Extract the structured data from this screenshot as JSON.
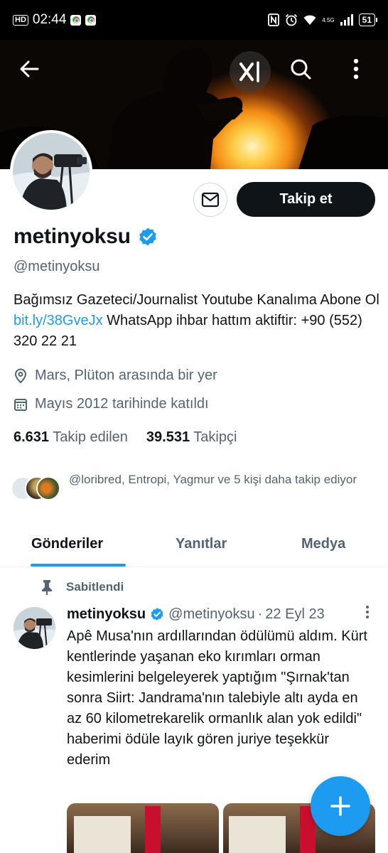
{
  "status_bar": {
    "hd": "HD",
    "time": "02:44",
    "network": "4.5G",
    "battery": "51"
  },
  "header": {
    "icons": [
      "back-arrow-icon",
      "grok-icon",
      "search-icon",
      "more-vertical-icon"
    ]
  },
  "profile": {
    "display_name": "metinyoksu",
    "verified": true,
    "handle": "@metinyoksu",
    "follow_label": "Takip et",
    "bio_part1": "Bağımsız Gazeteci/Journalist  Youtube Kanalıma Abone Ol ",
    "bio_link": "bit.ly/38GveJx",
    "bio_part2": "  WhatsApp ihbar hattım aktiftir:  +90 (552) 320 22 21",
    "location": "Mars, Plüton arasında bir yer",
    "joined": "Mayıs 2012 tarihinde katıldı",
    "following_count": "6.631",
    "following_label": "Takip edilen",
    "followers_count": "39.531",
    "followers_label": "Takipçi",
    "followed_by": "@loribred, Entropi, Yagmur ve 5 kişi daha takip ediyor"
  },
  "tabs": [
    {
      "label": "Gönderiler",
      "active": true
    },
    {
      "label": "Yanıtlar",
      "active": false
    },
    {
      "label": "Medya",
      "active": false
    }
  ],
  "pinned_tweet": {
    "pinned_label": "Sabitlendi",
    "name": "metinyoksu",
    "handle": "@metinyoksu",
    "dot": "·",
    "date": "22 Eyl 23",
    "text": "Apê Musa'nın ardıllarından ödülümü aldım. Kürt kentlerinde yaşanan eko kırımları orman kesimlerini belgeleyerek yaptığım \"Şırnak'tan sonra Siirt: Jandrama'nın talebiyle altı ayda en az 60 kilometrekarelik ormanlık alan yok edildi\" haberimi ödüle layık gören juriye teşekkür ederim"
  },
  "colors": {
    "accent": "#1d9bf0",
    "text_primary": "#0f1419",
    "text_secondary": "#536471"
  }
}
